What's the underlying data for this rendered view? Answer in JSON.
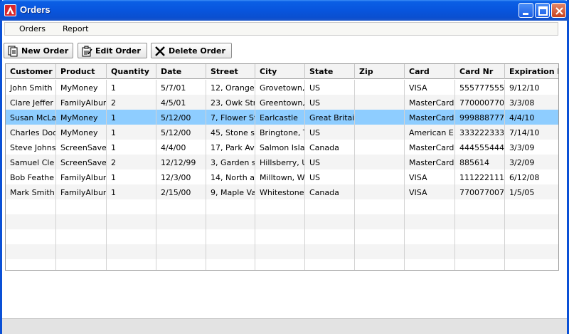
{
  "window": {
    "title": "Orders",
    "controls": [
      "minimize",
      "maximize",
      "close"
    ]
  },
  "menu": {
    "items": [
      "Orders",
      "Report"
    ]
  },
  "toolbar": {
    "new_label": "New Order",
    "edit_label": "Edit Order",
    "delete_label": "Delete Order"
  },
  "table": {
    "columns": [
      "Customer n",
      "Product",
      "Quantity",
      "Date",
      "Street",
      "City",
      "State",
      "Zip",
      "Card",
      "Card Nr",
      "Expiration D"
    ],
    "selected_row": 2,
    "rows": [
      [
        "John Smith",
        "MyMoney",
        "1",
        "5/7/01",
        "12, Orange",
        "Grovetown,",
        "US",
        "",
        "VISA",
        "555777555",
        "9/12/10"
      ],
      [
        "Clare Jeffer",
        "FamilyAlbur",
        "2",
        "4/5/01",
        "23, Owk Str",
        "Greentown,",
        "US",
        "",
        "MasterCard",
        "770000770",
        "3/3/08"
      ],
      [
        "Susan McLa",
        "MyMoney",
        "1",
        "5/12/00",
        "7, Flower St",
        "Earlcastle",
        "Great Britai",
        "",
        "MasterCard",
        "999888777",
        "4/4/10"
      ],
      [
        "Charles Doo",
        "MyMoney",
        "1",
        "5/12/00",
        "45, Stone s",
        "Bringtone, T",
        "US",
        "",
        "American E:",
        "333222333",
        "7/14/10"
      ],
      [
        "Steve Johns:",
        "ScreenSave",
        "1",
        "4/4/00",
        "17, Park Av",
        "Salmon Isla",
        "Canada",
        "",
        "MasterCard",
        "444555444",
        "3/3/09"
      ],
      [
        "Samuel Cle",
        "ScreenSave",
        "2",
        "12/12/99",
        "3, Garden s",
        "Hillsberry, U",
        "US",
        "",
        "MasterCard",
        "885614",
        "3/2/09"
      ],
      [
        "Bob Feathe",
        "FamilyAlbur",
        "1",
        "12/3/00",
        "14, North a",
        "Milltown, W",
        "US",
        "",
        "VISA",
        "111222111",
        "6/12/08"
      ],
      [
        "Mark Smith",
        "FamilyAlbur",
        "1",
        "2/15/00",
        "9, Maple Va",
        "Whitestone",
        "Canada",
        "",
        "VISA",
        "770077007",
        "1/5/05"
      ]
    ],
    "empty_rows": 5
  },
  "colors": {
    "selection": "#8ecdff",
    "titlebar": "#0855dd",
    "close": "#c8421f"
  }
}
